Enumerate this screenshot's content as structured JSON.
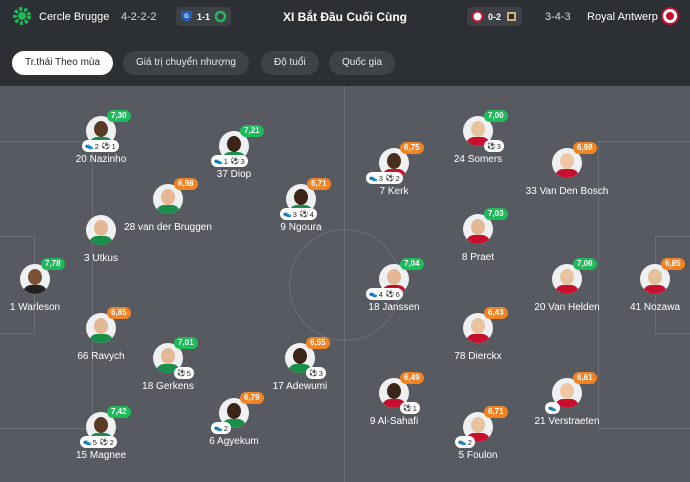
{
  "header": {
    "home_team": "Cercle Brugge",
    "home_formation": "4-2-2-2",
    "home_score_pill": "1-1",
    "title": "XI Bắt Đầu Cuối Cùng",
    "away_score_pill": "0-2",
    "away_formation": "3-4-3",
    "away_team": "Royal Antwerp",
    "colors": {
      "home_logo": "#1fba5a",
      "away_logo": "#c8102e",
      "genk_blue": "#1f5fbf"
    }
  },
  "tabs": [
    {
      "label": "Tr.thái Theo mùa",
      "active": true
    },
    {
      "label": "Giá trị chuyển nhượng",
      "active": false
    },
    {
      "label": "Độ tuổi",
      "active": false
    },
    {
      "label": "Quốc gia",
      "active": false
    }
  ],
  "players": [
    {
      "name": "20 Nazinho",
      "rating": "7,30",
      "color": "green",
      "assists": "2",
      "goals": "1"
    },
    {
      "name": "37 Diop",
      "rating": "7,21",
      "color": "green",
      "assists": "1",
      "goals": "3"
    },
    {
      "name": "28 van der Bruggen",
      "rating": "6,98",
      "color": "orange"
    },
    {
      "name": "9 Ngoura",
      "rating": "6,71",
      "color": "orange",
      "assists": "3",
      "goals": "4"
    },
    {
      "name": "3 Utkus"
    },
    {
      "name": "1 Warleson",
      "rating": "7,78",
      "color": "green"
    },
    {
      "name": "66 Ravych",
      "rating": "6,85",
      "color": "orange"
    },
    {
      "name": "18 Gerkens",
      "rating": "7,01",
      "color": "green",
      "goals": "5"
    },
    {
      "name": "17 Adewumi",
      "rating": "6,55",
      "color": "orange",
      "goals": "3"
    },
    {
      "name": "6 Agyekum",
      "rating": "6,79",
      "color": "orange",
      "assists": "2"
    },
    {
      "name": "15 Magnee",
      "rating": "7,42",
      "color": "green",
      "assists": "5",
      "goals": "2"
    },
    {
      "name": "24 Somers",
      "rating": "7,00",
      "color": "green",
      "goals": "3"
    },
    {
      "name": "7 Kerk",
      "rating": "6,75",
      "color": "orange",
      "assists": "3",
      "goals": "2"
    },
    {
      "name": "33 Van Den Bosch",
      "rating": "6,98",
      "color": "orange"
    },
    {
      "name": "8 Praet",
      "rating": "7,03",
      "color": "green"
    },
    {
      "name": "18 Janssen",
      "rating": "7,04",
      "color": "green",
      "assists": "4",
      "goals": "6"
    },
    {
      "name": "20 Van Helden",
      "rating": "7,06",
      "color": "green"
    },
    {
      "name": "41 Nozawa",
      "rating": "6,85",
      "color": "orange"
    },
    {
      "name": "78 Dierckx",
      "rating": "6,43",
      "color": "orange"
    },
    {
      "name": "9 Al-Sahafi",
      "rating": "6,49",
      "color": "orange",
      "goals": "1"
    },
    {
      "name": "21 Verstraeten",
      "rating": "6,61",
      "color": "orange",
      "assists": ""
    },
    {
      "name": "5 Foulon",
      "rating": "6,71",
      "color": "orange",
      "assists": "2"
    }
  ]
}
